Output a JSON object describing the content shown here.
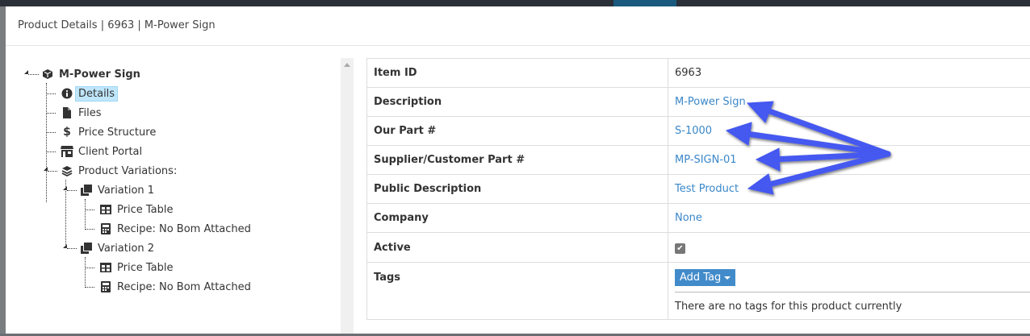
{
  "modal": {
    "title": "Product Details | 6963 | M-Power Sign"
  },
  "tree": {
    "root": "M-Power Sign",
    "items": [
      {
        "label": "Details",
        "icon": "info-circle-icon"
      },
      {
        "label": "Files",
        "icon": "file-icon"
      },
      {
        "label": "Price Structure",
        "icon": "dollar-icon"
      },
      {
        "label": "Client Portal",
        "icon": "store-icon"
      },
      {
        "label": "Product Variations:",
        "icon": "layers-icon"
      }
    ],
    "variations": [
      {
        "label": "Variation 1",
        "children": [
          "Price Table",
          "Recipe: No Bom Attached"
        ]
      },
      {
        "label": "Variation 2",
        "children": [
          "Price Table",
          "Recipe: No Bom Attached"
        ]
      }
    ]
  },
  "details": {
    "rows": [
      {
        "key": "Item ID",
        "value": "6963"
      },
      {
        "key": "Description",
        "value": "M-Power Sign"
      },
      {
        "key": "Our Part #",
        "value": "S-1000"
      },
      {
        "key": "Supplier/Customer Part #",
        "value": "MP-SIGN-01"
      },
      {
        "key": "Public Description",
        "value": "Test Product"
      },
      {
        "key": "Company",
        "value": "None"
      },
      {
        "key": "Active",
        "value": "checked"
      },
      {
        "key": "Tags"
      }
    ],
    "add_tag_label": "Add Tag",
    "no_tags_text": "There are no tags for this product currently"
  },
  "colors": {
    "arrow": "#4458f0",
    "link": "#3a87c8",
    "button": "#428bca",
    "selected": "#bfe6fb"
  }
}
